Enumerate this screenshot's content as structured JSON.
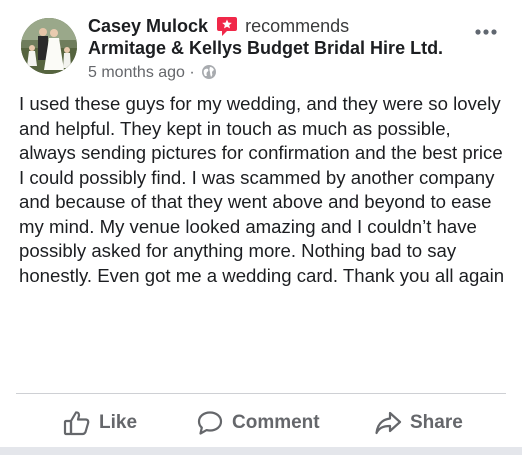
{
  "post": {
    "author": "Casey Mulock",
    "action_text": "recommends",
    "page_name": "Armitage & Kellys Budget Bridal Hire Ltd.",
    "timestamp": "5 months ago",
    "separator": "·",
    "audience_icon": "globe-icon",
    "recommend_icon": "recommend-flag-icon",
    "body": "I used these guys for my wedding, and they were so lovely and helpful. They kept in touch as much as possible, always sending pictures for confirmation and the best price I could possibly find. I was scammed by another company and because of that they went above and beyond to ease my mind. My venue looked amazing and I couldn’t have possibly asked for anything more. Nothing bad to say honestly. Even got me a wedding card. Thank you all again"
  },
  "actions": {
    "like_label": "Like",
    "comment_label": "Comment",
    "share_label": "Share"
  },
  "colors": {
    "text": "#1c1e21",
    "muted": "#65676b",
    "recommend": "#f02849",
    "divider": "#ced0d4"
  }
}
